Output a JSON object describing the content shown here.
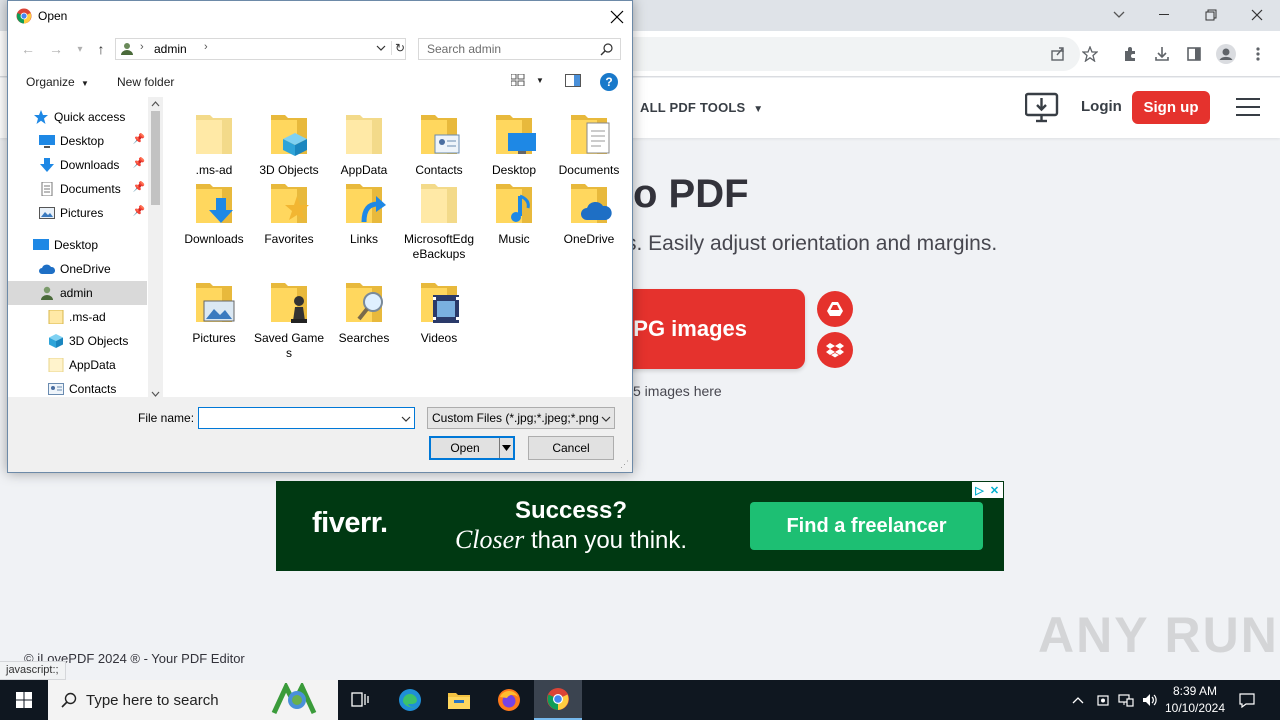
{
  "browser": {
    "minimize_icon": "minimize-icon",
    "restore_icon": "restore-icon",
    "close_icon": "close-icon"
  },
  "site": {
    "nav_tools": "ALL PDF TOOLS",
    "login": "Login",
    "signup": "Sign up",
    "title": "o PDF",
    "subtitle": "s. Easily adjust orientation and margins.",
    "select_button": "PG images",
    "drop_hint": "5 images here",
    "footer": "© iLovePDF 2024 ® - Your PDF Editor",
    "accent_color": "#e5322d"
  },
  "ad": {
    "logo": "fiverr.",
    "line1": "Success?",
    "line2_italic": "Closer",
    "line2_rest": " than you think.",
    "cta": "Find a freelancer"
  },
  "status_bar": "javascript:;",
  "watermark": "ANY RUN",
  "dialog": {
    "title": "Open",
    "breadcrumb": "admin",
    "search_placeholder": "Search admin",
    "organize": "Organize",
    "new_folder": "New folder",
    "help": "?",
    "nav_items": [
      {
        "label": "Quick access",
        "icon": "star-icon",
        "pinned": false
      },
      {
        "label": "Desktop",
        "icon": "desktop-icon",
        "pinned": true
      },
      {
        "label": "Downloads",
        "icon": "download-arrow-icon",
        "pinned": true
      },
      {
        "label": "Documents",
        "icon": "document-icon",
        "pinned": true
      },
      {
        "label": "Pictures",
        "icon": "picture-icon",
        "pinned": true
      },
      {
        "label": "Desktop",
        "icon": "desktop-icon",
        "pinned": false
      },
      {
        "label": "OneDrive",
        "icon": "cloud-icon",
        "pinned": false
      },
      {
        "label": "admin",
        "icon": "user-icon",
        "pinned": false,
        "selected": true
      },
      {
        "label": ".ms-ad",
        "icon": "folder-icon",
        "pinned": false
      },
      {
        "label": "3D Objects",
        "icon": "cube-icon",
        "pinned": false
      },
      {
        "label": "AppData",
        "icon": "folder-icon",
        "pinned": false
      },
      {
        "label": "Contacts",
        "icon": "contacts-icon",
        "pinned": false
      }
    ],
    "files": [
      {
        "name": ".ms-ad",
        "overlay": "none"
      },
      {
        "name": "3D Objects",
        "overlay": "cube"
      },
      {
        "name": "AppData",
        "overlay": "none"
      },
      {
        "name": "Contacts",
        "overlay": "contacts"
      },
      {
        "name": "Desktop",
        "overlay": "desktop"
      },
      {
        "name": "Documents",
        "overlay": "document"
      },
      {
        "name": "Downloads",
        "overlay": "download"
      },
      {
        "name": "Favorites",
        "overlay": "star"
      },
      {
        "name": "Links",
        "overlay": "link"
      },
      {
        "name": "MicrosoftEdgeBackups",
        "overlay": "none"
      },
      {
        "name": "Music",
        "overlay": "music"
      },
      {
        "name": "OneDrive",
        "overlay": "cloud"
      },
      {
        "name": "Pictures",
        "overlay": "picture"
      },
      {
        "name": "Saved Games",
        "overlay": "chess"
      },
      {
        "name": "Searches",
        "overlay": "magnifier"
      },
      {
        "name": "Videos",
        "overlay": "film"
      }
    ],
    "file_name_label": "File name:",
    "file_name_value": "",
    "file_type": "Custom Files (*.jpg;*.jpeg;*.png",
    "open_button": "Open",
    "cancel_button": "Cancel"
  },
  "taskbar": {
    "search_placeholder": "Type here to search",
    "time": "8:39 AM",
    "date": "10/10/2024"
  }
}
